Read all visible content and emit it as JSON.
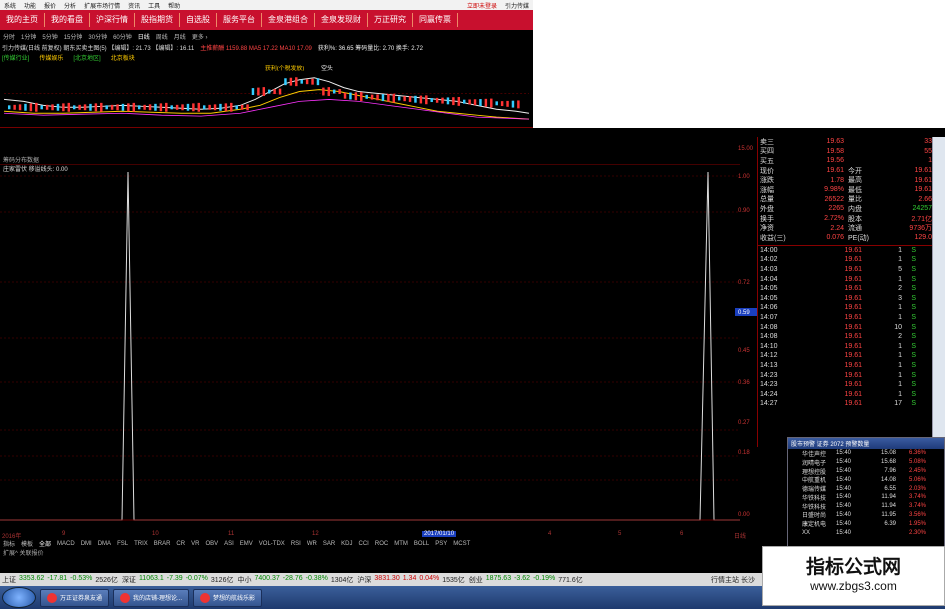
{
  "menubar": {
    "items": [
      "系统",
      "功能",
      "报价",
      "分析",
      "扩展市场行情",
      "资讯",
      "工具",
      "帮助"
    ],
    "right": [
      "立即未登录",
      "引力传媒"
    ]
  },
  "mainnav": {
    "items": [
      "我的主页",
      "我的看盘",
      "沪深行情",
      "股指期货",
      "自选股",
      "服务平台",
      "金泉港组合",
      "金泉发现财",
      "万正研究",
      "同赢传票"
    ]
  },
  "periodbar": {
    "items": [
      "分时",
      "1分钟",
      "5分钟",
      "15分钟",
      "30分钟",
      "60分钟",
      "日线",
      "周线",
      "月线",
      "更多 ›"
    ],
    "selected": "日线"
  },
  "pricebar": {
    "left": "引力传媒(日线 前复权) 朝东买卖主图(5) 【编辑】: 21.73 【编辑】: 16.11",
    "mid": "主推薪酬 1159.88 MA5 17.22 MA10 17.09",
    "right": "获利%: 36.65 筹码量比: 2.70 换手: 2.72"
  },
  "tags": {
    "items": [
      "[传媒行业]",
      "传媒娱乐",
      "[北京地区]",
      "北京板块"
    ]
  },
  "topchart_labels": {
    "a": "获利(个税发放)",
    "b": "空头"
  },
  "indicator": {
    "title": "筹码分布数据",
    "name": "庄家雷伏 移溢线头: 0.00"
  },
  "yaxis": {
    "labels": [
      "15.00",
      "1.00",
      "0.90",
      "0.72",
      "0.59",
      "0.45",
      "0.36",
      "0.27",
      "0.18",
      "0.00"
    ],
    "highlight": "0.59"
  },
  "quote": {
    "rows": [
      {
        "l": "卖三",
        "v": "19.63",
        "r": "",
        "n": "33"
      },
      {
        "l": "买四",
        "v": "19.58",
        "r": "",
        "n": "55"
      },
      {
        "l": "买五",
        "v": "19.56",
        "r": "",
        "n": "1"
      },
      {
        "l": "现价",
        "v": "19.61",
        "r": "今开",
        "n": "19.61"
      },
      {
        "l": "涨跌",
        "v": "1.78",
        "r": "最高",
        "n": "19.61"
      },
      {
        "l": "涨幅",
        "v": "9.98%",
        "r": "最低",
        "n": "19.61"
      },
      {
        "l": "总量",
        "v": "26522",
        "r": "量比",
        "n": "2.66"
      },
      {
        "l": "外盘",
        "v": "2265",
        "r": "内盘",
        "n": "24257"
      },
      {
        "l": "换手",
        "v": "2.72%",
        "r": "股本",
        "n": "2.71亿"
      },
      {
        "l": "净资",
        "v": "2.24",
        "r": "流通",
        "n": "9736万"
      },
      {
        "l": "收益(三)",
        "v": "0.076",
        "r": "PE(动)",
        "n": "129.0"
      }
    ],
    "ticks": [
      {
        "t": "14:00",
        "p": "19.61",
        "v": "1",
        "s": "S"
      },
      {
        "t": "14:02",
        "p": "19.61",
        "v": "1",
        "s": "S"
      },
      {
        "t": "14:03",
        "p": "19.61",
        "v": "5",
        "s": "S"
      },
      {
        "t": "14:04",
        "p": "19.61",
        "v": "1",
        "s": "S"
      },
      {
        "t": "14:05",
        "p": "19.61",
        "v": "2",
        "s": "S"
      },
      {
        "t": "14:05",
        "p": "19.61",
        "v": "3",
        "s": "S"
      },
      {
        "t": "14:06",
        "p": "19.61",
        "v": "1",
        "s": "S"
      },
      {
        "t": "14:07",
        "p": "19.61",
        "v": "1",
        "s": "S"
      },
      {
        "t": "14:08",
        "p": "19.61",
        "v": "10",
        "s": "S"
      },
      {
        "t": "14:08",
        "p": "19.61",
        "v": "2",
        "s": "S"
      },
      {
        "t": "14:10",
        "p": "19.61",
        "v": "1",
        "s": "S"
      },
      {
        "t": "14:12",
        "p": "19.61",
        "v": "1",
        "s": "S"
      },
      {
        "t": "14:13",
        "p": "19.61",
        "v": "1",
        "s": "S"
      },
      {
        "t": "14:23",
        "p": "19.61",
        "v": "1",
        "s": "S"
      },
      {
        "t": "14:23",
        "p": "19.61",
        "v": "1",
        "s": "S"
      },
      {
        "t": "14:24",
        "p": "19.61",
        "v": "1",
        "s": "S"
      },
      {
        "t": "14:27",
        "p": "19.61",
        "v": "17",
        "s": "S"
      }
    ]
  },
  "popup": {
    "title": "股市预警 证券 2072 预警数量",
    "rows": [
      {
        "n": "华佳声控",
        "tm": "15:40",
        "pr": "15.08",
        "pc": "6.36%"
      },
      {
        "n": "润晴电子",
        "tm": "15:40",
        "pr": "15.68",
        "pc": "5.08%"
      },
      {
        "n": "理想控股",
        "tm": "15:40",
        "pr": "7.96",
        "pc": "2.45%"
      },
      {
        "n": "中航重机",
        "tm": "15:40",
        "pr": "14.08",
        "pc": "5.06%"
      },
      {
        "n": "德瑞传媒",
        "tm": "15:40",
        "pr": "6.55",
        "pc": "2.03%"
      },
      {
        "n": "华铁科技",
        "tm": "15:40",
        "pr": "11.94",
        "pc": "3.74%"
      },
      {
        "n": "华铁科技",
        "tm": "15:40",
        "pr": "11.94",
        "pc": "3.74%"
      },
      {
        "n": "日盛时尚",
        "tm": "15:40",
        "pr": "11.95",
        "pc": "3.56%"
      },
      {
        "n": "康定机电",
        "tm": "15:40",
        "pr": "6.39",
        "pc": "1.95%"
      },
      {
        "n": "XX",
        "tm": "15:40",
        "pr": "",
        "pc": "2.30%"
      }
    ]
  },
  "dates": {
    "items": [
      "2016年",
      "9",
      "10",
      "11",
      "12",
      "2017/01/10",
      "4",
      "5",
      "6",
      "日线"
    ]
  },
  "tabs": {
    "items": [
      "指标",
      "模板",
      "全部",
      "MACD",
      "DMI",
      "DMA",
      "FSL",
      "TRIX",
      "BRAR",
      "CR",
      "VR",
      "OBV",
      "ASI",
      "EMV",
      "VOL-TDX",
      "RSI",
      "WR",
      "SAR",
      "KDJ",
      "CCI",
      "ROC",
      "MTM",
      "BOLL",
      "PSY",
      "MCST"
    ],
    "selected": "全部"
  },
  "expand": {
    "label": "扩展^  关联报价"
  },
  "statusbar": {
    "items": [
      {
        "name": "上证",
        "v": "3353.62",
        "c": "-17.81",
        "p": "-0.53%",
        "a": "2526亿"
      },
      {
        "name": "深证",
        "v": "11063.1",
        "c": "-7.39",
        "p": "-0.07%",
        "a": "3126亿"
      },
      {
        "name": "中小",
        "v": "7400.37",
        "c": "-28.76",
        "p": "-0.38%",
        "a": "1304亿"
      },
      {
        "name": "沪深",
        "v": "3831.30",
        "c": "1.34",
        "p": "0.04%",
        "a": "1535亿"
      },
      {
        "name": "创业",
        "v": "1875.63",
        "c": "-3.62",
        "p": "-0.19%",
        "a": "771.6亿"
      }
    ],
    "right": "行情主站 长沙"
  },
  "taskbar": {
    "items": [
      "万正证券泉友通",
      "我的店铺-理想论...",
      "梦想的航线乐影"
    ]
  },
  "watermark": {
    "line1": "指标公式网",
    "line2": "www.zbgs3.com"
  },
  "colors": {
    "red": "#c8102e",
    "up": "#ff4444",
    "down": "#33cc33",
    "axis": "#a33"
  }
}
